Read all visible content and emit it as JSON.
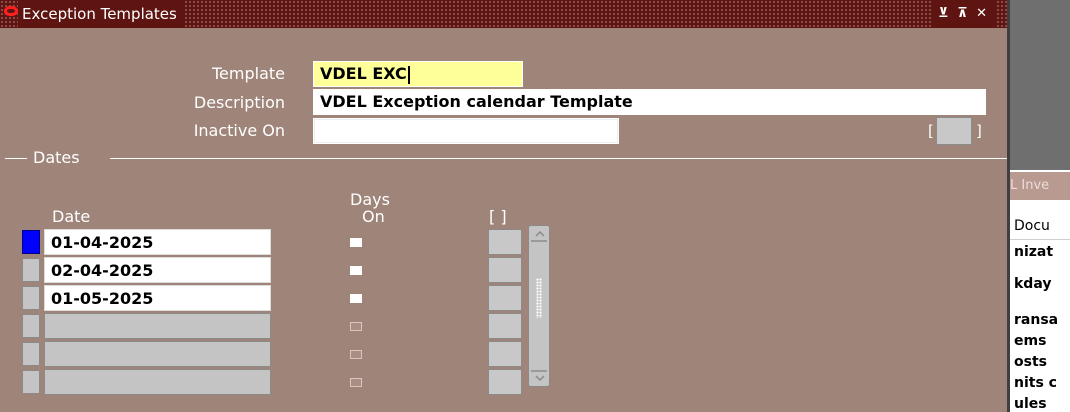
{
  "window": {
    "title": "Exception Templates",
    "controls": "⊻ ⊼ ✕"
  },
  "form": {
    "template_label": "Template",
    "template_value": "VDEL EXC",
    "description_label": "Description",
    "description_value": "VDEL Exception calendar Template",
    "inactive_label": "Inactive On",
    "inactive_value": "",
    "dff_open": "[",
    "dff_close": "]"
  },
  "dates": {
    "section_label": "Dates",
    "col_date": "Date",
    "col_days": "Days",
    "col_on": "On",
    "col_dff": "[ ]",
    "rows": [
      {
        "date": "01-04-2025",
        "on": true
      },
      {
        "date": "02-04-2025",
        "on": true
      },
      {
        "date": "01-05-2025",
        "on": true
      },
      {
        "date": "",
        "on": false
      },
      {
        "date": "",
        "on": false
      },
      {
        "date": "",
        "on": false
      }
    ]
  },
  "background": {
    "tab_text": "L Inve",
    "doc_text": "Docu",
    "lines": [
      "nizat",
      "kday",
      "ransa",
      "ems",
      "osts",
      "nits c",
      "ules"
    ]
  },
  "colors": {
    "window_bg": "#9e8479",
    "titlebar": "#5e1512",
    "required_field": "#ffff99",
    "record_indicator_active": "#0000ff"
  }
}
